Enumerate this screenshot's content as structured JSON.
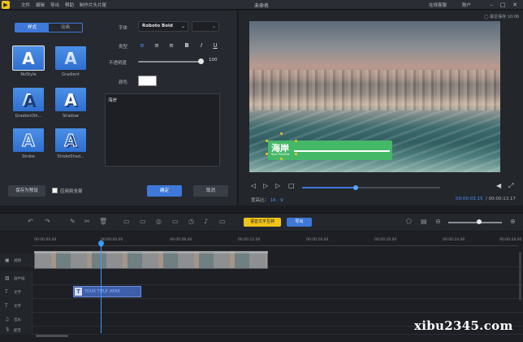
{
  "titlebar": {
    "menu": [
      "文件",
      "编辑",
      "导出",
      "帮助",
      "制作片头片尾"
    ],
    "title": "未命名",
    "help": "在线客服",
    "account": "账户"
  },
  "left_panel": {
    "tabs": [
      "样式",
      "动画"
    ],
    "styles": [
      {
        "label": "NoStyle",
        "glyph": "A"
      },
      {
        "label": "Gradient",
        "glyph": "A"
      },
      {
        "label": "GradientSh...",
        "glyph": "A"
      },
      {
        "label": "Shadow",
        "glyph": "A"
      },
      {
        "label": "Stroke",
        "glyph": "A"
      },
      {
        "label": "StrokeShad...",
        "glyph": "A"
      }
    ],
    "font_label": "字体",
    "font_value": "Roboto Bold",
    "type_label": "类型",
    "format": {
      "bold": "B",
      "italic": "I",
      "underline": "U"
    },
    "opacity_label": "不透明度",
    "opacity_value": "100",
    "opacity_level": 1.0,
    "color_label": "颜色",
    "color_value": "#ffffff",
    "text_value": "海岸",
    "save_preset": "保存为预设",
    "apply_all": "应用到全部",
    "ok": "确定",
    "cancel": "取消"
  },
  "preview": {
    "autosave": "◯ 最近保存 10:06",
    "overlay_text": "海岸",
    "overlay_sub": "Your Pictures",
    "aspect_label": "宽高比：",
    "aspect_value": "16 : 9",
    "time_current": "00:00:03.15",
    "time_total": "/ 00:00:13.17",
    "progress": 0.39
  },
  "toolbar": {
    "speech_to_text": "语音文字互转",
    "export": "导出"
  },
  "timeline": {
    "ticks": [
      "00:00:00.00",
      "00:00:04.00",
      "00:00:08.00",
      "00:00:12.00",
      "00:00:16.00",
      "00:00:20.00",
      "00:00:24.00",
      "00:00:28.00"
    ],
    "tracks": [
      {
        "name": "视频",
        "icon": "▣"
      },
      {
        "name": "画中画",
        "icon": "▨"
      },
      {
        "name": "文字",
        "icon": "T"
      },
      {
        "name": "文字",
        "icon": "T"
      },
      {
        "name": "音乐",
        "icon": "♫"
      },
      {
        "name": "配音",
        "icon": "🎙"
      }
    ],
    "text_clip_label": "YOUR TITLE HERE",
    "text_clip_icon": "T"
  },
  "watermark": "xibu2345.com",
  "colors": {
    "accent": "#3e78d8",
    "highlight": "#f0c419",
    "overlay_green": "#45b868"
  }
}
